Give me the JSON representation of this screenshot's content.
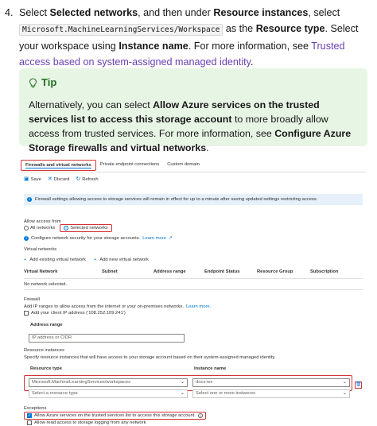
{
  "step": {
    "number": "4.",
    "t1": "Select ",
    "b1": "Selected networks",
    "t2": ", and then under ",
    "b2": "Resource instances",
    "t3": ", select ",
    "code": "Microsoft.MachineLearningServices/Workspace",
    "t4": " as the ",
    "b3": "Resource type",
    "t5": ". Select your workspace using ",
    "b4": "Instance name",
    "t6": ". For more information, see ",
    "link": "Trusted access based on system-assigned managed identity",
    "t7": "."
  },
  "tip": {
    "heading": "Tip",
    "t1": "Alternatively, you can select ",
    "b1": "Allow Azure services on the trusted services list to access this storage account",
    "t2": " to more broadly allow access from trusted services. For more information, see ",
    "b2": "Configure Azure Storage firewalls and virtual networks",
    "t3": "."
  },
  "portal": {
    "tabs": [
      "Firewalls and virtual networks",
      "Private endpoint connections",
      "Custom domain"
    ],
    "toolbar": {
      "save": "Save",
      "discard": "Discard",
      "refresh": "Refresh"
    },
    "info": "Firewall settings allowing access to storage services will remain in effect for up to a minute after saving updated settings restricting access.",
    "allow_access_from": "Allow access from",
    "all_networks": "All networks",
    "selected_networks": "Selected networks",
    "configure_text": "Configure network security for your storage accounts.",
    "learn_more": "Learn more",
    "virtual_networks": "Virtual networks",
    "add_existing": "Add existing virtual network",
    "add_new": "Add new virtual network",
    "vnet_headers": [
      "Virtual Network",
      "Subnet",
      "Address range",
      "Endpoint Status",
      "Resource Group",
      "Subscription"
    ],
    "no_network": "No network selected.",
    "firewall": "Firewall",
    "firewall_desc": "Add IP ranges to allow access from the internet or your on-premises networks.",
    "firewall_learn": "Learn more.",
    "add_client_ip": "Add your client IP address ('108.252.109.241')",
    "address_range": "Address range",
    "ip_placeholder": "IP address or CIDR",
    "resource_instances": "Resource instances",
    "resource_desc": "Specify resource instances that will have access to your storage account based on their system-assigned managed identity.",
    "resource_type_label": "Resource type",
    "instance_name_label": "Instance name",
    "resource_type_value": "Microsoft.MachineLearningServices/workspaces",
    "instance_value": "docs-ws",
    "resource_type_placeholder": "Select a resource type",
    "instance_placeholder": "Select one or more instances",
    "exceptions": "Exceptions",
    "exception1": "Allow Azure services on the trusted services list to access this storage account.",
    "exception2": "Allow read access to storage logging from any network"
  },
  "colors": {
    "accent": "#0078d4",
    "highlight": "#d13438",
    "tip_bg": "#e7f5e5",
    "link": "#6a3fb0"
  }
}
